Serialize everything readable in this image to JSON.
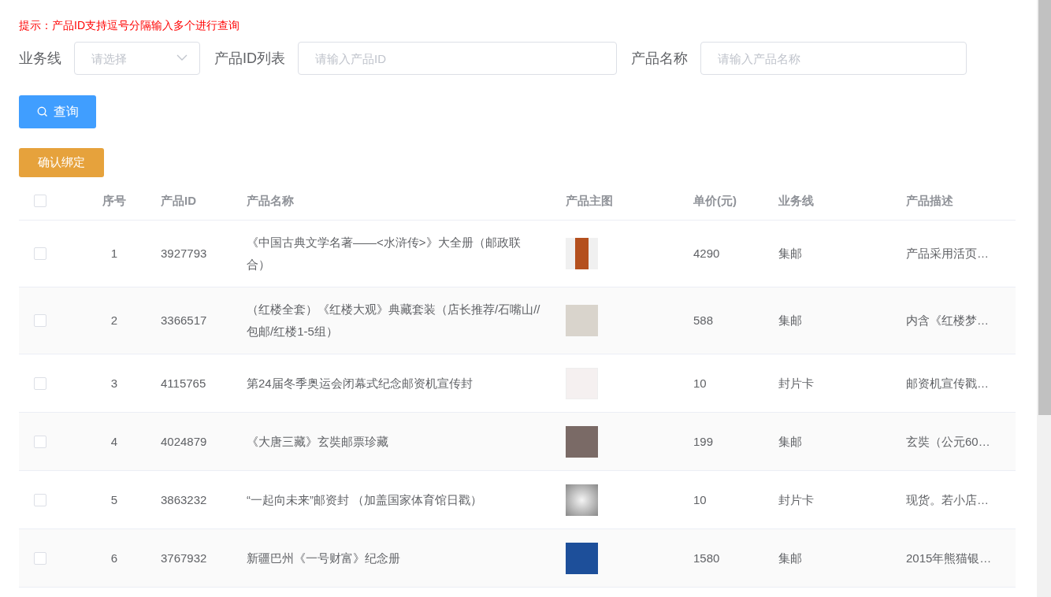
{
  "hint": "提示：产品ID支持逗号分隔输入多个进行查询",
  "filters": [
    {
      "label": "业务线",
      "kind": "select",
      "placeholder": "请选择"
    },
    {
      "label": "产品ID列表",
      "kind": "input",
      "placeholder": "请输入产品ID"
    },
    {
      "label": "产品名称",
      "kind": "input",
      "placeholder": "请输入产品名称"
    }
  ],
  "search_button": "查询",
  "bind_button": "确认绑定",
  "table": {
    "select_all": {
      "checked": false
    },
    "columns": [
      "序号",
      "产品ID",
      "产品名称",
      "产品主图",
      "单价(元)",
      "业务线",
      "产品描述"
    ],
    "rows": [
      {
        "checked": false,
        "index": "1",
        "id": "3927793",
        "name": "《中国古典文学名著——<水浒传>》大全册（邮政联合）",
        "price": "4290",
        "line": "集邮",
        "desc": "产品采用活页…"
      },
      {
        "checked": false,
        "index": "2",
        "id": "3366517",
        "name": "（红楼全套）《红楼大观》典藏套装（店长推荐/石嘴山//包邮/红楼1-5组）",
        "price": "588",
        "line": "集邮",
        "desc": "内含《红楼梦…"
      },
      {
        "checked": false,
        "index": "3",
        "id": "4115765",
        "name": "第24届冬季奥运会闭幕式纪念邮资机宣传封",
        "price": "10",
        "line": "封片卡",
        "desc": "邮资机宣传戳…"
      },
      {
        "checked": false,
        "index": "4",
        "id": "4024879",
        "name": "《大唐三藏》玄奘邮票珍藏",
        "price": "199",
        "line": "集邮",
        "desc": "玄奘（公元60…"
      },
      {
        "checked": false,
        "index": "5",
        "id": "3863232",
        "name": "“一起向未来”邮资封 （加盖国家体育馆日戳）",
        "price": "10",
        "line": "封片卡",
        "desc": "现货。若小店…"
      },
      {
        "checked": false,
        "index": "6",
        "id": "3767932",
        "name": "新疆巴州《一号财富》纪念册",
        "price": "1580",
        "line": "集邮",
        "desc": "2015年熊猫银…"
      }
    ]
  }
}
